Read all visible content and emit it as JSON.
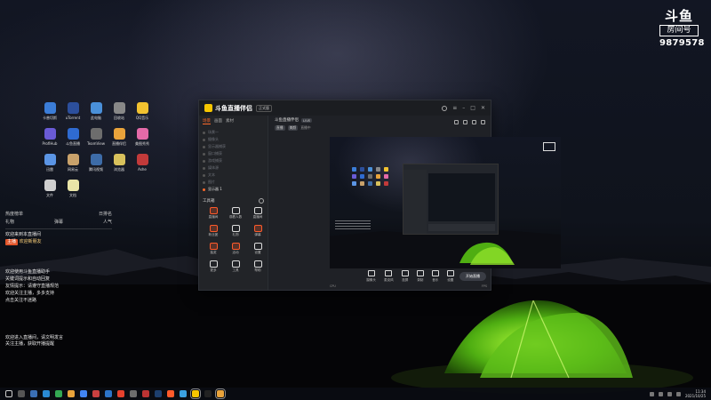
{
  "brand": {
    "logo": "斗鱼",
    "tag": "房间号",
    "room_number": "9879578"
  },
  "desktop_icons": [
    {
      "label": "卡普切斯",
      "icon": "app-icon",
      "color": "#3b7dd8"
    },
    {
      "label": "uTorrent",
      "icon": "app-icon",
      "color": "#2c4f9c"
    },
    {
      "label": "此电脑",
      "icon": "computer-icon",
      "color": "#4a90d9"
    },
    {
      "label": "回收站",
      "icon": "recycle-bin-icon",
      "color": "#888888"
    },
    {
      "label": "QQ音乐",
      "icon": "app-icon",
      "color": "#f2c230"
    },
    {
      "label": "ProfiHub",
      "icon": "app-icon",
      "color": "#6a5bd6"
    },
    {
      "label": "斗鱼直播",
      "icon": "app-icon",
      "color": "#2f6bd1"
    },
    {
      "label": "TeamView",
      "icon": "app-icon",
      "color": "#6d6d6d"
    },
    {
      "label": "直播伴侣",
      "icon": "app-icon",
      "color": "#e9a33b"
    },
    {
      "label": "美图秀秀",
      "icon": "app-icon",
      "color": "#e46aa8"
    },
    {
      "label": "迅雷",
      "icon": "app-icon",
      "color": "#5b95e5"
    },
    {
      "label": "网易云",
      "icon": "app-icon",
      "color": "#c9a26b"
    },
    {
      "label": "腾讯视频",
      "icon": "app-icon",
      "color": "#3d6ca8"
    },
    {
      "label": "浏览器",
      "icon": "app-icon",
      "color": "#d8c15c"
    },
    {
      "label": "Ashe",
      "icon": "app-icon",
      "color": "#c23a3a"
    },
    {
      "label": "文件",
      "icon": "folder-icon",
      "color": "#cfcfcf"
    },
    {
      "label": "文档",
      "icon": "document-icon",
      "color": "#e9e5a8"
    }
  ],
  "chat": {
    "header_left": "热度榜单",
    "header_right": "日排名",
    "stats": [
      "礼物",
      "弹幕",
      "人气"
    ],
    "line1": "欢迎来到本直播间",
    "line2_badge": "主播",
    "line2_text": "欢迎新朋友",
    "lines": [
      "欢迎使用斗鱼直播助手",
      "关键词提示和自动回复",
      "友情提示：请遵守直播规范",
      "欢迎关注主播，多多支持",
      "点击关注不迷路"
    ]
  },
  "chat2": {
    "lines": [
      "欢迎进入直播间，请文明发言",
      "关注主播，获取开播提醒"
    ]
  },
  "window": {
    "app_name": "斗鱼直播伴侣",
    "version": "正式版",
    "tabs": [
      "场景",
      "画面",
      "素材"
    ],
    "scene_items": [
      "场景一",
      "摄像头",
      "显示器捕获",
      "窗口捕获",
      "游戏捕获",
      "媒体源",
      "文本",
      "图片"
    ],
    "selected_item": "显示器 1",
    "tools_header": "工具箱",
    "tools": [
      {
        "label": "直播间",
        "red": true
      },
      {
        "label": "观看人数",
        "red": false
      },
      {
        "label": "直播间",
        "red": false
      },
      {
        "label": "粉丝团",
        "red": true
      },
      {
        "label": "礼物",
        "red": false
      },
      {
        "label": "弹幕",
        "red": true
      },
      {
        "label": "抽奖",
        "red": true
      },
      {
        "label": "活动",
        "red": true
      },
      {
        "label": "设置",
        "red": false
      },
      {
        "label": "更多",
        "red": false
      },
      {
        "label": "工具",
        "red": false
      },
      {
        "label": "帮助",
        "red": false
      }
    ],
    "title": "斗鱼直播伴侣",
    "title_badge": "LIVE",
    "sub_pills": [
      "直播",
      "美颜"
    ],
    "sub_text": "直播中",
    "bottom_items": [
      "摄像头",
      "麦克风",
      "投屏",
      "录制",
      "音乐",
      "设置"
    ],
    "start_button": "开始直播",
    "status_left": "CPU",
    "status_right": "FPS"
  },
  "taskbar": {
    "clock_time": "11:34",
    "clock_date": "2021/10/25"
  }
}
